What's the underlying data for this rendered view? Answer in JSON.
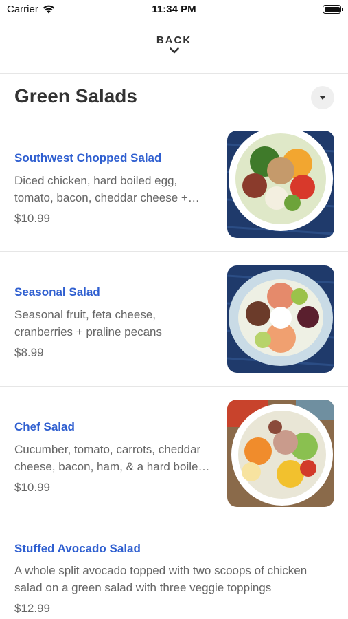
{
  "status_bar": {
    "carrier": "Carrier",
    "time": "11:34 PM"
  },
  "nav": {
    "back_label": "BACK"
  },
  "header": {
    "title": "Green Salads"
  },
  "menu_items": [
    {
      "name": "Southwest Chopped Salad",
      "description": "Diced chicken, hard boiled egg, tomato, bacon, cheddar cheese +…",
      "price": "$10.99"
    },
    {
      "name": "Seasonal Salad",
      "description": "Seasonal fruit, feta cheese, cranberries + praline pecans",
      "price": "$8.99"
    },
    {
      "name": "Chef Salad",
      "description": "Cucumber, tomato, carrots, cheddar cheese, bacon, ham, & a hard boile…",
      "price": "$10.99"
    },
    {
      "name": "Stuffed Avocado Salad",
      "description": "A whole split avocado topped with two scoops of chicken salad on a green salad with three veggie toppings",
      "price": "$12.99"
    }
  ],
  "colors": {
    "item_name": "#2f5fd0",
    "text_secondary": "#666666",
    "divider": "#e6e6e6"
  }
}
